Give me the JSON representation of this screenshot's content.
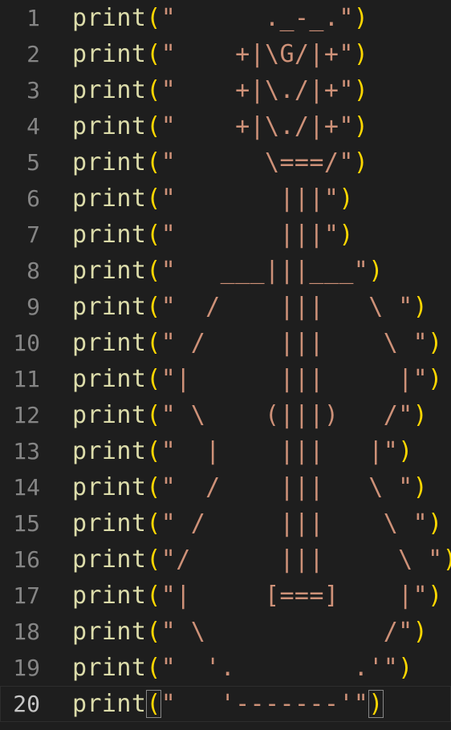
{
  "editor": {
    "function_name": "print",
    "open_paren": "(",
    "close_paren": ")",
    "current_line": 20,
    "lines": [
      {
        "number": "1",
        "string": "\"      ._-_.\""
      },
      {
        "number": "2",
        "string": "\"    +|\\G/|+\""
      },
      {
        "number": "3",
        "string": "\"    +|\\./|+\""
      },
      {
        "number": "4",
        "string": "\"    +|\\./|+\""
      },
      {
        "number": "5",
        "string": "\"      \\===/\""
      },
      {
        "number": "6",
        "string": "\"       |||\""
      },
      {
        "number": "7",
        "string": "\"       |||\""
      },
      {
        "number": "8",
        "string": "\"   ___|||___\""
      },
      {
        "number": "9",
        "string": "\"  /    |||   \\ \""
      },
      {
        "number": "10",
        "string": "\" /     |||    \\ \""
      },
      {
        "number": "11",
        "string": "\"|      |||     |\""
      },
      {
        "number": "12",
        "string": "\" \\    (|||)   /\""
      },
      {
        "number": "13",
        "string": "\"  |    |||   |\""
      },
      {
        "number": "14",
        "string": "\"  /    |||   \\ \""
      },
      {
        "number": "15",
        "string": "\" /     |||    \\ \""
      },
      {
        "number": "16",
        "string": "\"/      |||     \\ \""
      },
      {
        "number": "17",
        "string": "\"|     [===]    |\""
      },
      {
        "number": "18",
        "string": "\" \\            /\""
      },
      {
        "number": "19",
        "string": "\"  '.        .'\""
      },
      {
        "number": "20",
        "string": "\"   '-------'\""
      }
    ]
  },
  "colors": {
    "background": "#1e1e1e",
    "line_number": "#858585",
    "line_number_active": "#c6c6c6",
    "function": "#dcdcaa",
    "bracket": "#ffd700",
    "string": "#ce9178"
  }
}
